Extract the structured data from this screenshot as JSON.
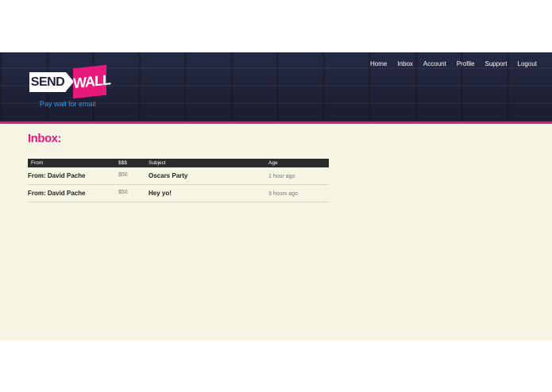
{
  "brand": {
    "logo_left": "SEND",
    "logo_right": "WALL",
    "tagline": "Pay wall for email"
  },
  "nav": {
    "items": [
      {
        "label": "Home"
      },
      {
        "label": "Inbox"
      },
      {
        "label": "Account"
      },
      {
        "label": "Profile"
      },
      {
        "label": "Support"
      },
      {
        "label": "Logout"
      }
    ]
  },
  "page": {
    "title": "Inbox:"
  },
  "table": {
    "headers": {
      "from": "From",
      "amount": "$$$",
      "subject": "Subject",
      "age": "Age"
    },
    "rows": [
      {
        "from": "From: David Pache",
        "amount": "$50",
        "subject": "Oscars Party",
        "age": "1 hour ago"
      },
      {
        "from": "From: David Pache",
        "amount": "$50",
        "subject": "Hey yo!",
        "age": "3 hours ago"
      }
    ]
  },
  "colors": {
    "accent": "#e8197a",
    "header_bg": "#1e2238",
    "content_bg": "#f6f4e2",
    "tagline": "#2a9be6"
  }
}
